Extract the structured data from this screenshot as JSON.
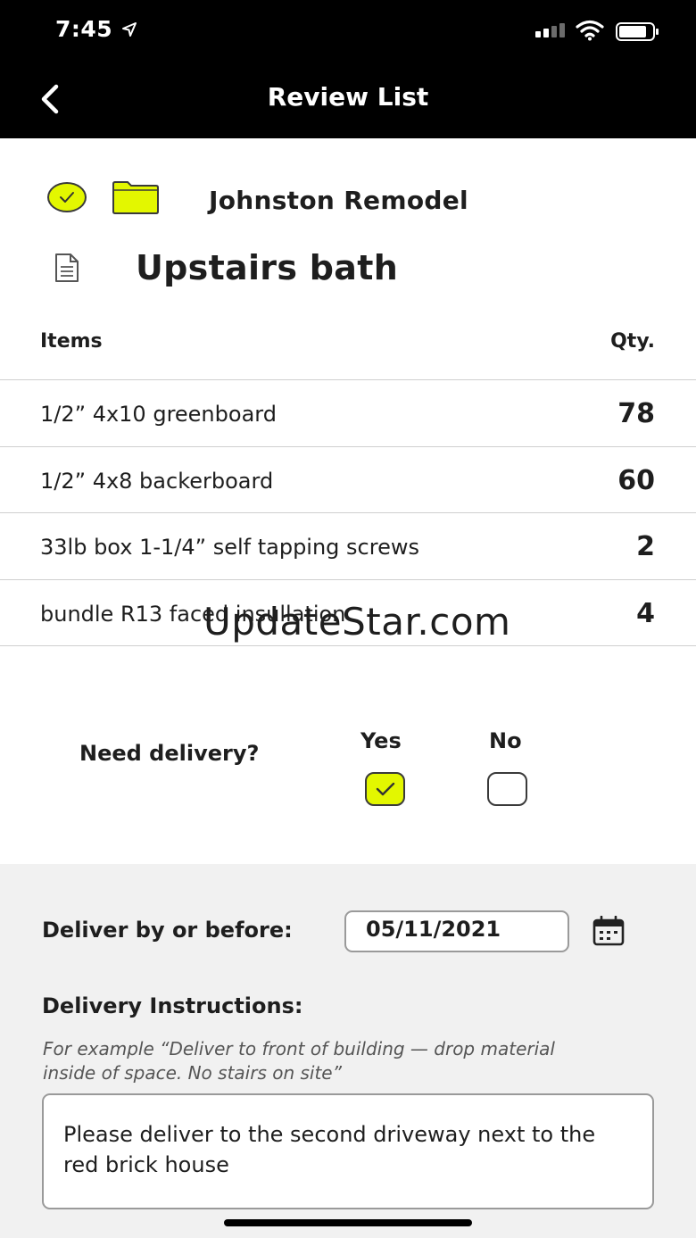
{
  "status_bar": {
    "time": "7:45",
    "icons": [
      "location-arrow-icon",
      "cellular-signal-icon",
      "wifi-icon",
      "battery-icon"
    ]
  },
  "header": {
    "title": "Review List",
    "back_icon": "chevron-left-icon"
  },
  "project": {
    "name": "Johnston Remodel",
    "list_name": "Upstairs bath",
    "accent_color": "#e3f700",
    "icons": [
      "check-circle-icon",
      "folder-icon",
      "document-icon"
    ]
  },
  "table": {
    "headers": {
      "items": "Items",
      "qty": "Qty."
    },
    "rows": [
      {
        "name": "1/2” 4x10 greenboard",
        "qty": "78"
      },
      {
        "name": "1/2” 4x8 backerboard",
        "qty": "60"
      },
      {
        "name": "33lb box 1-1/4” self tapping screws",
        "qty": "2"
      },
      {
        "name": "bundle R13 faced insullation",
        "qty": "4"
      }
    ]
  },
  "watermark": "UpdateStar.com",
  "delivery": {
    "question": "Need delivery?",
    "yes_label": "Yes",
    "no_label": "No",
    "selected": "Yes",
    "deliver_by_label": "Deliver by or before:",
    "date_value": "05/11/2021",
    "instructions_label": "Delivery Instructions:",
    "instructions_hint": "For example “Deliver to front of building — drop material inside of space. No stairs on site”",
    "instructions_value": "Please deliver to the second driveway next to the red brick house"
  }
}
